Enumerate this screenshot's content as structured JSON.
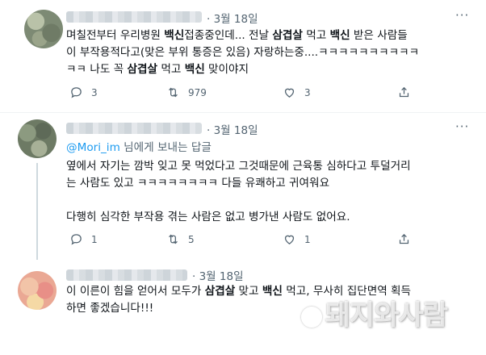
{
  "tweets": [
    {
      "date": "3월 18일",
      "more": "···",
      "lines": [
        [
          {
            "t": "며칠전부터 우리병원 "
          },
          {
            "t": "백신",
            "b": true
          },
          {
            "t": "접종중인데... 전날 "
          },
          {
            "t": "삼겹살",
            "b": true
          },
          {
            "t": " 먹고 "
          },
          {
            "t": "백신",
            "b": true
          },
          {
            "t": " 받은 사람들"
          }
        ],
        [
          {
            "t": "이 부작용적다고(맞은 부위 통증은 있음) 자랑하는중....ㅋㅋㅋㅋㅋㅋㅋㅋㅋㅋ"
          }
        ],
        [
          {
            "t": "ㅋㅋ 나도 꼭 "
          },
          {
            "t": "삼겹살",
            "b": true
          },
          {
            "t": " 먹고 "
          },
          {
            "t": "백신",
            "b": true
          },
          {
            "t": " 맞이야지"
          }
        ]
      ],
      "reply_count": "3",
      "retweet_count": "979",
      "like_count": "3"
    },
    {
      "date": "3월 18일",
      "more": "···",
      "reply_to_handle": "@Mori_im",
      "reply_to_suffix": " 님에게 보내는 답글",
      "lines": [
        [
          {
            "t": "옆에서 자기는 깜박 잊고 못 먹었다고 그것때문에 근육통 심하다고 투덜거리"
          }
        ],
        [
          {
            "t": "는 사람도 있고 ㅋㅋㅋㅋㅋㅋㅋㅋ 다들 유쾌하고 귀여워요"
          }
        ],
        [
          {
            "t": ""
          }
        ],
        [
          {
            "t": "다행히 심각한 부작용 겪는 사람은 없고 병가낸 사람도 없어요."
          }
        ]
      ],
      "reply_count": "1",
      "retweet_count": "5",
      "like_count": "1"
    },
    {
      "date": "3월 18일",
      "lines": [
        [
          {
            "t": "이 이른이 힘을 얻어서 모두가 "
          },
          {
            "t": "삼겹살",
            "b": true
          },
          {
            "t": " 맞고 "
          },
          {
            "t": "백신",
            "b": true
          },
          {
            "t": " 먹고, 무사히 집단면역 획득"
          }
        ],
        [
          {
            "t": "하면 좋겠습니다!!!"
          }
        ]
      ]
    }
  ],
  "watermark": "돼지와사람",
  "colors": {
    "text": "#0f1419",
    "muted": "#536471",
    "link": "#1d9bf0",
    "divider": "#eff3f4"
  }
}
